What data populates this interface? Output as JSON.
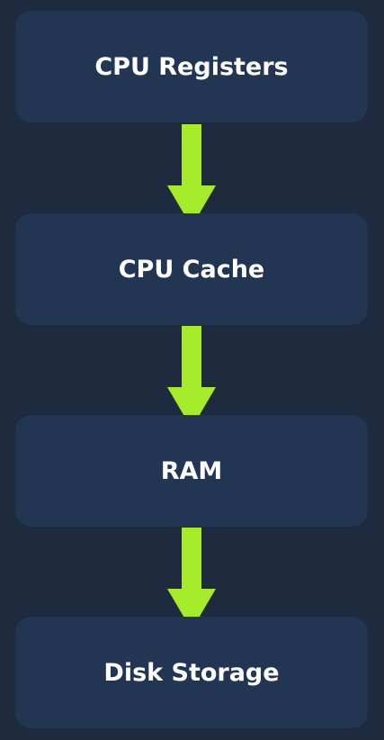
{
  "diagram": {
    "nodes": [
      {
        "label": "CPU Registers"
      },
      {
        "label": "CPU Cache"
      },
      {
        "label": "RAM"
      },
      {
        "label": "Disk Storage"
      }
    ],
    "edges": [
      {
        "from": 0,
        "to": 1
      },
      {
        "from": 1,
        "to": 2
      },
      {
        "from": 2,
        "to": 3
      }
    ]
  },
  "colors": {
    "background": "#1e2a3e",
    "node_fill": "#223553",
    "node_text": "#ffffff",
    "arrow": "#a5ea2b"
  }
}
